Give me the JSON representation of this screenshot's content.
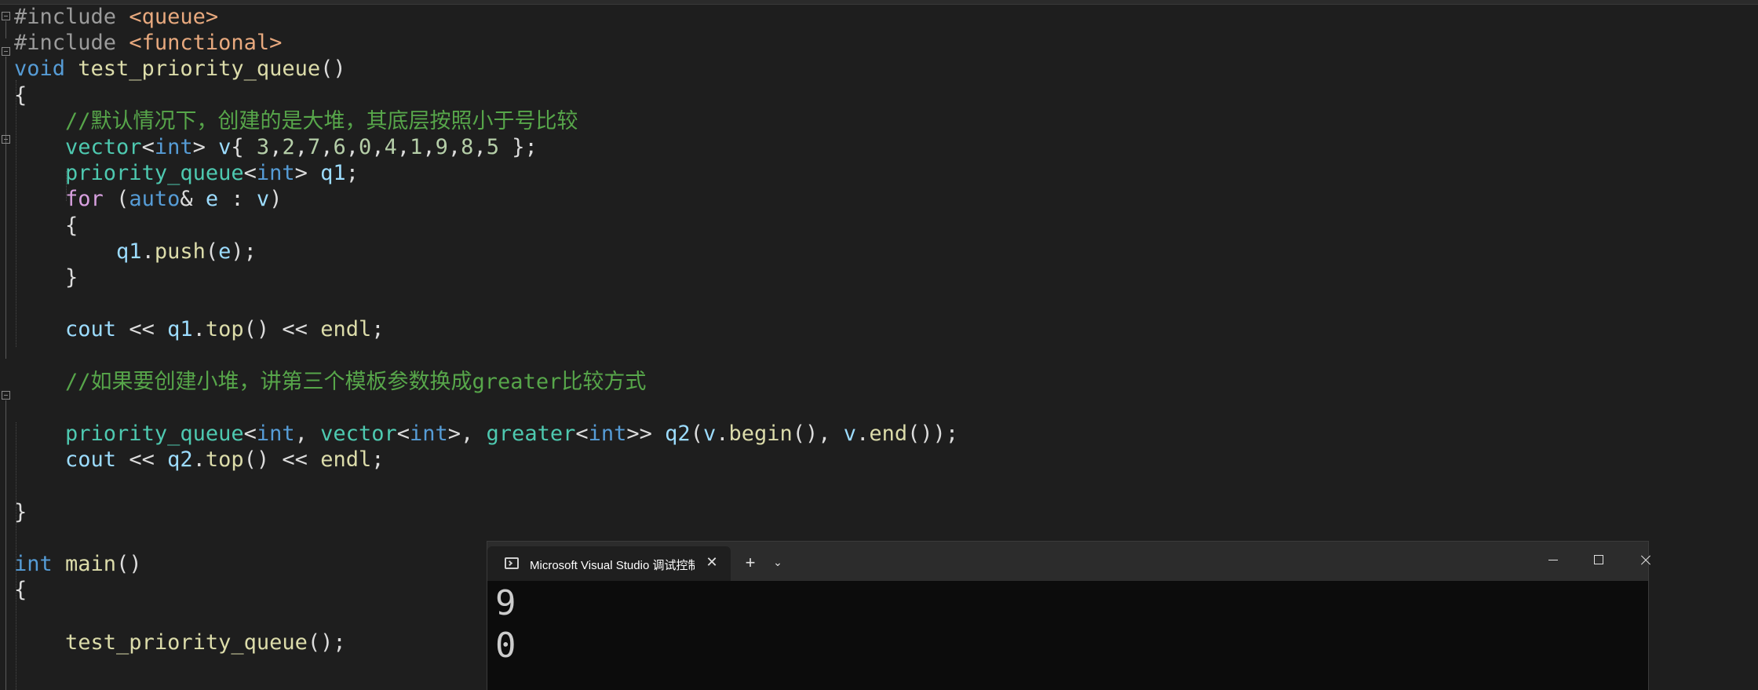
{
  "editor": {
    "lines": [
      {
        "parts": [
          [
            "pp",
            "#include "
          ],
          [
            "inc",
            "<queue>"
          ]
        ]
      },
      {
        "parts": [
          [
            "pp",
            "#include "
          ],
          [
            "inc",
            "<functional>"
          ]
        ]
      },
      {
        "parts": [
          [
            "kw",
            "void "
          ],
          [
            "fn",
            "test_priority_queue"
          ],
          [
            "pl",
            "()"
          ]
        ]
      },
      {
        "parts": [
          [
            "pl",
            "{"
          ]
        ]
      },
      {
        "parts": [
          [
            "pl",
            "    "
          ],
          [
            "cm",
            "//默认情况下，创建的是大堆，其底层按照小于号比较"
          ]
        ]
      },
      {
        "parts": [
          [
            "pl",
            "    "
          ],
          [
            "ty",
            "vector"
          ],
          [
            "pl",
            "<"
          ],
          [
            "kw",
            "int"
          ],
          [
            "pl",
            "> "
          ],
          [
            "var",
            "v"
          ],
          [
            "pl",
            "{ "
          ],
          [
            "nm",
            "3"
          ],
          [
            "pl",
            ","
          ],
          [
            "nm",
            "2"
          ],
          [
            "pl",
            ","
          ],
          [
            "nm",
            "7"
          ],
          [
            "pl",
            ","
          ],
          [
            "nm",
            "6"
          ],
          [
            "pl",
            ","
          ],
          [
            "nm",
            "0"
          ],
          [
            "pl",
            ","
          ],
          [
            "nm",
            "4"
          ],
          [
            "pl",
            ","
          ],
          [
            "nm",
            "1"
          ],
          [
            "pl",
            ","
          ],
          [
            "nm",
            "9"
          ],
          [
            "pl",
            ","
          ],
          [
            "nm",
            "8"
          ],
          [
            "pl",
            ","
          ],
          [
            "nm",
            "5"
          ],
          [
            "pl",
            " };"
          ]
        ]
      },
      {
        "parts": [
          [
            "pl",
            "    "
          ],
          [
            "ty",
            "priority_queue"
          ],
          [
            "pl",
            "<"
          ],
          [
            "kw",
            "int"
          ],
          [
            "pl",
            "> "
          ],
          [
            "var",
            "q1"
          ],
          [
            "pl",
            ";"
          ]
        ]
      },
      {
        "parts": [
          [
            "pl",
            "    "
          ],
          [
            "kwc",
            "for"
          ],
          [
            "pl",
            " ("
          ],
          [
            "kw",
            "auto"
          ],
          [
            "pl",
            "& "
          ],
          [
            "var",
            "e"
          ],
          [
            "pl",
            " : "
          ],
          [
            "var",
            "v"
          ],
          [
            "pl",
            ")"
          ]
        ]
      },
      {
        "parts": [
          [
            "pl",
            "    {"
          ]
        ]
      },
      {
        "parts": [
          [
            "pl",
            "        "
          ],
          [
            "var",
            "q1"
          ],
          [
            "pl",
            "."
          ],
          [
            "fn",
            "push"
          ],
          [
            "pl",
            "("
          ],
          [
            "var",
            "e"
          ],
          [
            "pl",
            ");"
          ]
        ]
      },
      {
        "parts": [
          [
            "pl",
            "    }"
          ]
        ]
      },
      {
        "parts": [
          [
            "pl",
            ""
          ]
        ]
      },
      {
        "parts": [
          [
            "pl",
            "    "
          ],
          [
            "var",
            "cout"
          ],
          [
            "pl",
            " << "
          ],
          [
            "var",
            "q1"
          ],
          [
            "pl",
            "."
          ],
          [
            "fn",
            "top"
          ],
          [
            "pl",
            "() << "
          ],
          [
            "fn",
            "endl"
          ],
          [
            "pl",
            ";"
          ]
        ]
      },
      {
        "parts": [
          [
            "pl",
            ""
          ]
        ]
      },
      {
        "parts": [
          [
            "pl",
            "    "
          ],
          [
            "cm",
            "//如果要创建小堆，讲第三个模板参数换成greater比较方式"
          ]
        ]
      },
      {
        "parts": [
          [
            "pl",
            ""
          ]
        ]
      },
      {
        "parts": [
          [
            "pl",
            "    "
          ],
          [
            "ty",
            "priority_queue"
          ],
          [
            "pl",
            "<"
          ],
          [
            "kw",
            "int"
          ],
          [
            "pl",
            ", "
          ],
          [
            "ty",
            "vector"
          ],
          [
            "pl",
            "<"
          ],
          [
            "kw",
            "int"
          ],
          [
            "pl",
            ">, "
          ],
          [
            "ty",
            "greater"
          ],
          [
            "pl",
            "<"
          ],
          [
            "kw",
            "int"
          ],
          [
            "pl",
            ">> "
          ],
          [
            "var",
            "q2"
          ],
          [
            "pl",
            "("
          ],
          [
            "var",
            "v"
          ],
          [
            "pl",
            "."
          ],
          [
            "fn",
            "begin"
          ],
          [
            "pl",
            "(), "
          ],
          [
            "var",
            "v"
          ],
          [
            "pl",
            "."
          ],
          [
            "fn",
            "end"
          ],
          [
            "pl",
            "());"
          ]
        ]
      },
      {
        "parts": [
          [
            "pl",
            "    "
          ],
          [
            "var",
            "cout"
          ],
          [
            "pl",
            " << "
          ],
          [
            "var",
            "q2"
          ],
          [
            "pl",
            "."
          ],
          [
            "fn",
            "top"
          ],
          [
            "pl",
            "() << "
          ],
          [
            "fn",
            "endl"
          ],
          [
            "pl",
            ";"
          ]
        ]
      },
      {
        "parts": [
          [
            "pl",
            ""
          ]
        ]
      },
      {
        "parts": [
          [
            "pl",
            "}"
          ]
        ]
      },
      {
        "parts": [
          [
            "pl",
            ""
          ]
        ]
      },
      {
        "parts": [
          [
            "kw",
            "int "
          ],
          [
            "fn",
            "main"
          ],
          [
            "pl",
            "()"
          ]
        ]
      },
      {
        "parts": [
          [
            "pl",
            "{"
          ]
        ]
      },
      {
        "parts": [
          [
            "pl",
            ""
          ]
        ]
      },
      {
        "parts": [
          [
            "pl",
            "    "
          ],
          [
            "fn",
            "test_priority_queue"
          ],
          [
            "pl",
            "();"
          ]
        ]
      }
    ]
  },
  "terminal": {
    "tab_title": "Microsoft Visual Studio 调试控制台",
    "close_glyph": "✕",
    "new_tab_glyph": "+",
    "dropdown_glyph": "⌄",
    "output": [
      "9",
      "0"
    ]
  }
}
